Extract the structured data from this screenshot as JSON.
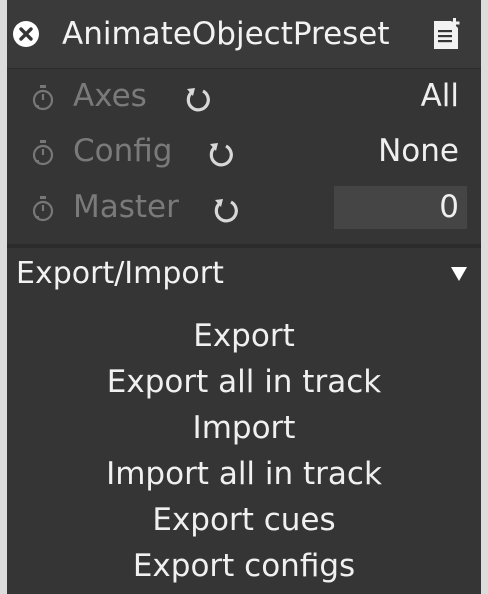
{
  "header": {
    "title": "AnimateObjectPreset",
    "close_icon": "close-icon",
    "menu_icon": "preset-menu-icon"
  },
  "params": [
    {
      "label": "Axes",
      "value": "All",
      "icons": [
        "stopwatch-icon",
        "reset-icon"
      ]
    },
    {
      "label": "Config",
      "value": "None",
      "icons": [
        "stopwatch-icon",
        "reset-icon"
      ]
    },
    {
      "label": "Master",
      "value": "0",
      "icons": [
        "stopwatch-icon",
        "reset-icon"
      ]
    }
  ],
  "section": {
    "title": "Export/Import",
    "expanded_icon": "triangle-down-icon",
    "actions": [
      "Export",
      "Export all in track",
      "Import",
      "Import all in track",
      "Export cues",
      "Export configs"
    ]
  },
  "colors": {
    "panel_bg": "#353535",
    "header_bg": "#3a3a3a",
    "disabled_text": "#7a7a7a",
    "field_bg": "#454545",
    "outer_bg": "#dcdcdc"
  }
}
